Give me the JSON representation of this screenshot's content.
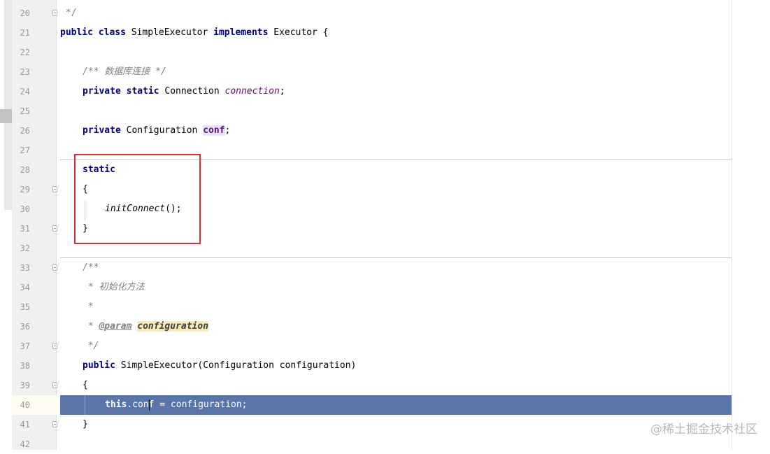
{
  "editor": {
    "lines": [
      {
        "no": "20",
        "text": " */"
      },
      {
        "no": "21",
        "kw1": "public class ",
        "name": "SimpleExecutor ",
        "kw2": "implements ",
        "iface": "Executor ",
        "brace": "{"
      },
      {
        "no": "22"
      },
      {
        "no": "23",
        "comment": "/** 数据库连接 */"
      },
      {
        "no": "24",
        "kw": "private static ",
        "type": "Connection ",
        "field": "connection",
        "end": ";"
      },
      {
        "no": "25"
      },
      {
        "no": "26",
        "kw": "private ",
        "type": "Configuration ",
        "field": "conf",
        "end": ";"
      },
      {
        "no": "27"
      },
      {
        "no": "28",
        "kw": "static"
      },
      {
        "no": "29",
        "brace": "{"
      },
      {
        "no": "30",
        "call": "initConnect",
        "args": "();"
      },
      {
        "no": "31",
        "brace": "}"
      },
      {
        "no": "32"
      },
      {
        "no": "33",
        "comment": "/**"
      },
      {
        "no": "34",
        "comment": " * 初始化方法"
      },
      {
        "no": "35",
        "comment": " *"
      },
      {
        "no": "36",
        "star": " * ",
        "tag": "@param",
        "param": "configuration"
      },
      {
        "no": "37",
        "comment": " */"
      },
      {
        "no": "38",
        "kw": "public ",
        "name": "SimpleExecutor",
        "sig": "(Configuration configuration)"
      },
      {
        "no": "39",
        "brace": "{"
      },
      {
        "no": "40",
        "kw": "this",
        "pre": ".con",
        "post": "f = configuration;"
      },
      {
        "no": "41",
        "brace": "}"
      },
      {
        "no": "42"
      }
    ]
  },
  "watermark": "@稀土掘金技术社区",
  "colors": {
    "keyword": "#000080",
    "field": "#660e7a",
    "comment": "#808080",
    "current_line": "#5a75aa",
    "highlight_box": "#d8353a"
  }
}
